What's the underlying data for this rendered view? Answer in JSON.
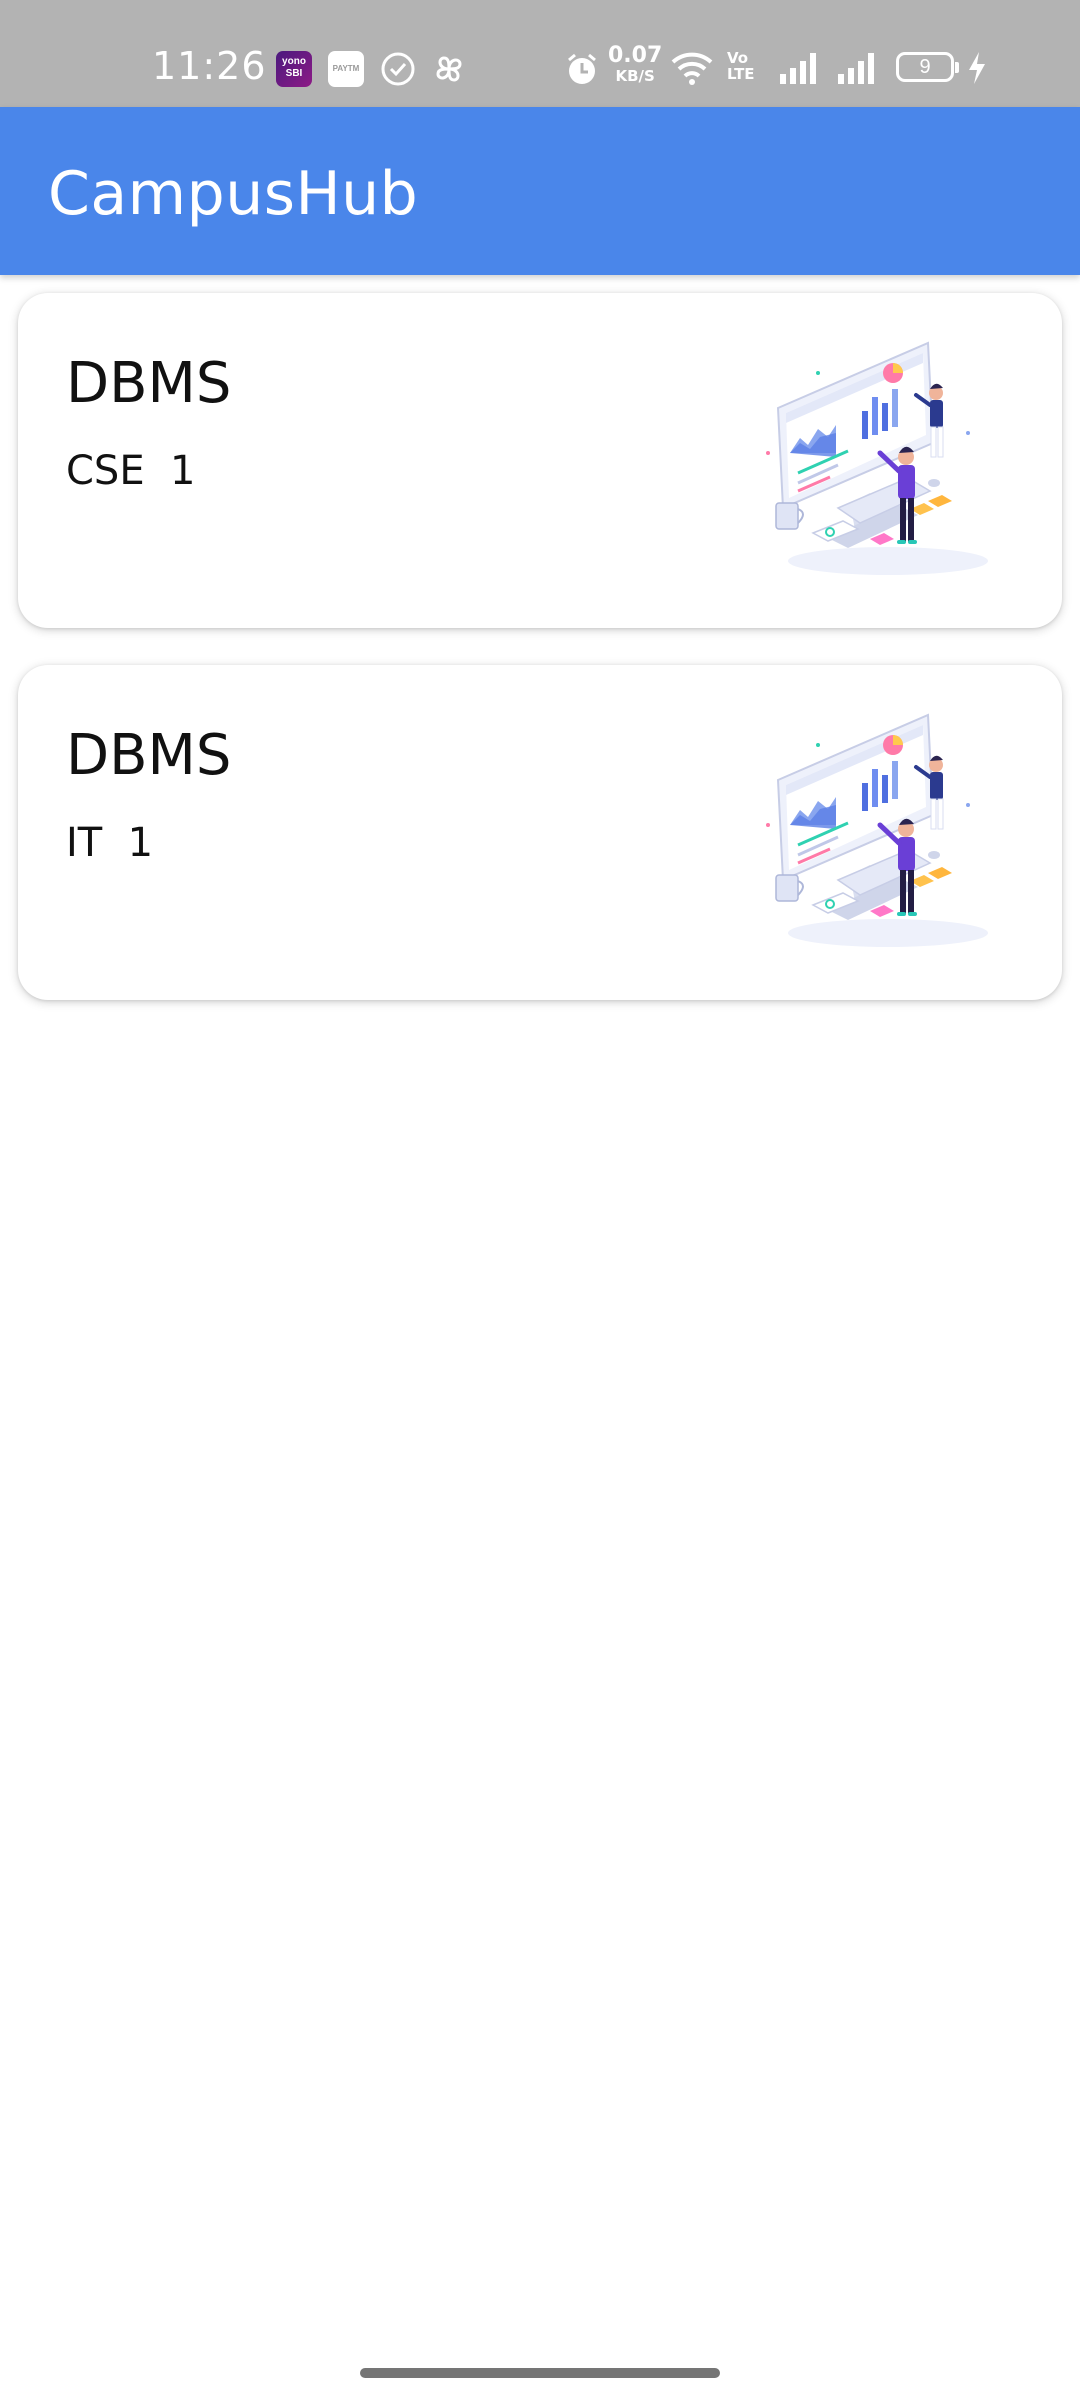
{
  "status_bar": {
    "time": "11:26",
    "yono_label": "yono SBI",
    "paytm_label": "PAYTM",
    "net_speed_value": "0.07",
    "net_speed_unit": "KB/S",
    "volte_label": "Vo LTE",
    "battery_level": "9",
    "icons": [
      "yono-sbi-app-icon",
      "paytm-app-icon",
      "check-circle-icon",
      "pinwheel-icon",
      "alarm-icon",
      "wifi-icon",
      "volte-icon",
      "signal-icon",
      "signal-icon",
      "battery-icon",
      "charging-icon"
    ]
  },
  "app_bar": {
    "title": "CampusHub",
    "color": "#4a86ea"
  },
  "courses": [
    {
      "title": "DBMS",
      "branch": "CSE",
      "year": "1",
      "image": "data-analytics-illustration"
    },
    {
      "title": "DBMS",
      "branch": "IT",
      "year": "1",
      "image": "data-analytics-illustration"
    }
  ]
}
